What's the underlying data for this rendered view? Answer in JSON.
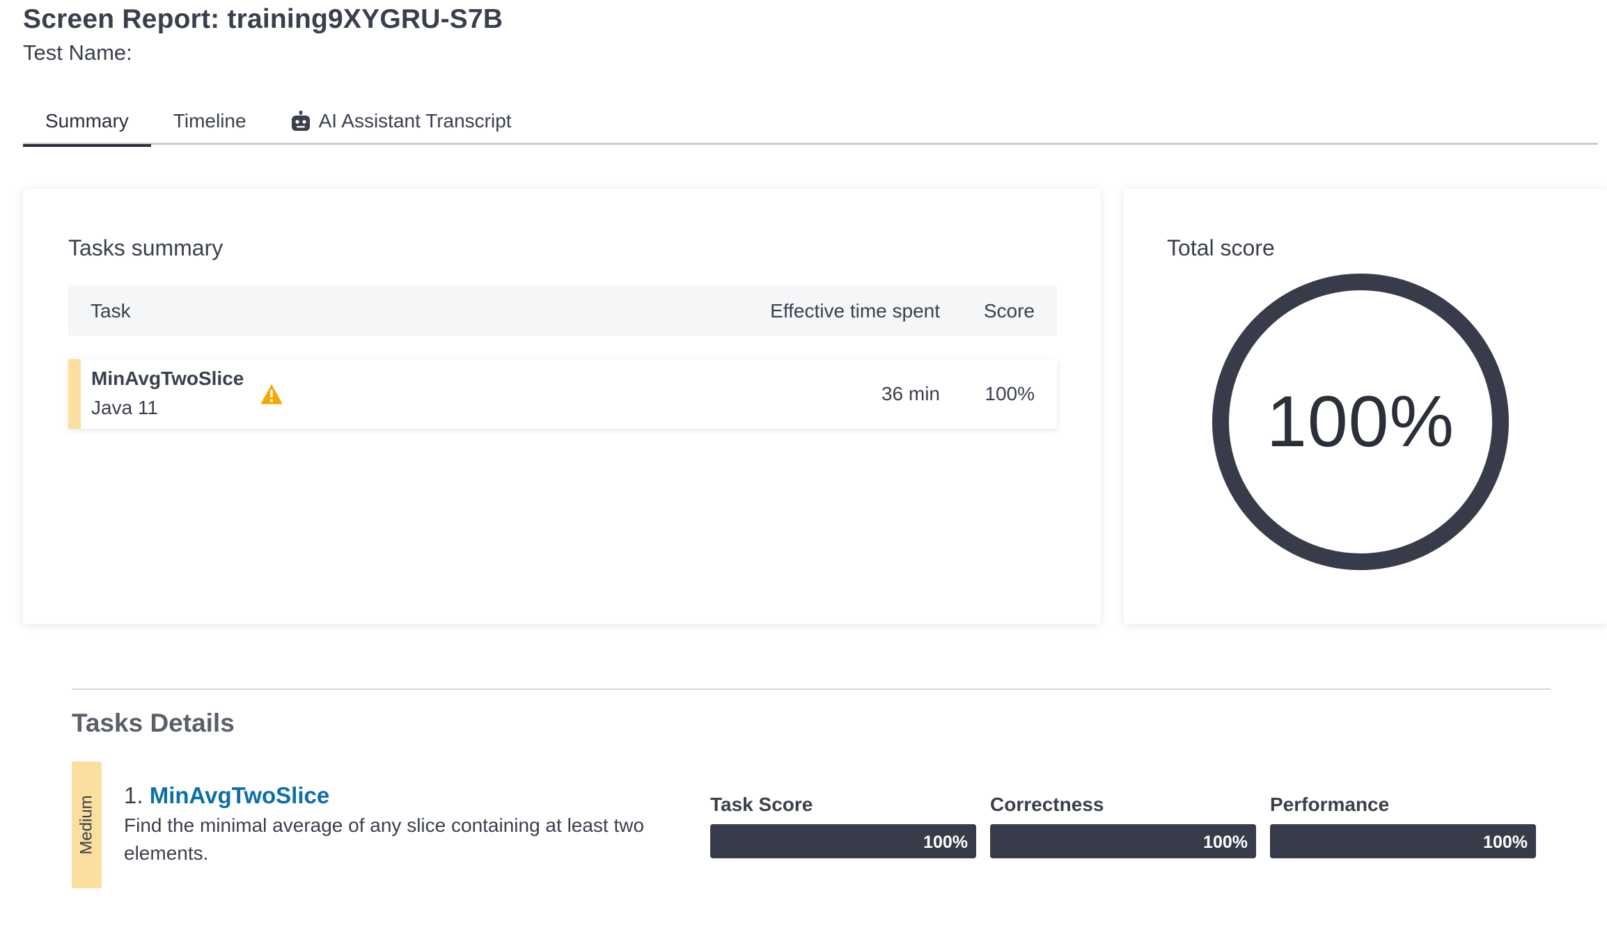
{
  "header": {
    "title": "Screen Report: training9XYGRU-S7B",
    "test_name_label": "Test Name:"
  },
  "tabs": [
    {
      "label": "Summary",
      "active": true
    },
    {
      "label": "Timeline",
      "active": false
    },
    {
      "label": "AI Assistant Transcript",
      "active": false,
      "icon": "robot-icon"
    }
  ],
  "tasks_summary": {
    "title": "Tasks summary",
    "columns": {
      "task": "Task",
      "time": "Effective time spent",
      "score": "Score"
    },
    "rows": [
      {
        "name": "MinAvgTwoSlice",
        "language": "Java 11",
        "warning_icon": "warning-icon",
        "time": "36 min",
        "score": "100%"
      }
    ]
  },
  "total_score": {
    "title": "Total score",
    "value": "100%",
    "fraction": 1.0
  },
  "tasks_details": {
    "title": "Tasks Details",
    "items": [
      {
        "difficulty": "Medium",
        "number": "1.",
        "name": "MinAvgTwoSlice",
        "description": "Find the minimal average of any slice containing at least two elements.",
        "metrics": [
          {
            "label": "Task Score",
            "value": "100%",
            "fraction": 1.0
          },
          {
            "label": "Correctness",
            "value": "100%",
            "fraction": 1.0
          },
          {
            "label": "Performance",
            "value": "100%",
            "fraction": 1.0
          }
        ]
      }
    ]
  },
  "colors": {
    "accent_dark": "#383c4a",
    "difficulty_medium": "#fbdf9e",
    "warning": "#f5a800",
    "link": "#0d6fa6"
  }
}
